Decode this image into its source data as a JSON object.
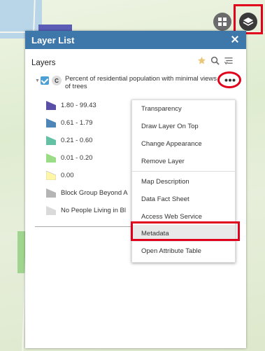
{
  "panel": {
    "title": "Layer List",
    "layers_label": "Layers"
  },
  "layer": {
    "badge": "C",
    "title": "Percent of residential population with minimal views of trees",
    "checked": true
  },
  "legend": [
    {
      "label": "1.80 - 99.43",
      "color": "#5a4fa6"
    },
    {
      "label": "0.61 - 1.79",
      "color": "#4f86b8"
    },
    {
      "label": "0.21 - 0.60",
      "color": "#64c1a6"
    },
    {
      "label": "0.01 - 0.20",
      "color": "#9bdc86"
    },
    {
      "label": "0.00",
      "color": "#fff7a6"
    },
    {
      "label": "Block Group Beyond A",
      "color": "#b5b5b5"
    },
    {
      "label": "No People Living in Bl",
      "color": "#dadada"
    }
  ],
  "menu": {
    "items": [
      "Transparency",
      "Draw Layer On Top",
      "Change Appearance",
      "Remove Layer",
      "Map Description",
      "Data Fact Sheet",
      "Access Web Service",
      "Metadata",
      "Open Attribute Table"
    ],
    "selected": "Metadata"
  },
  "colors": {
    "header": "#3e78ab",
    "highlight": "#e0001b",
    "checkbox": "#4a9fd4"
  },
  "icons": {
    "basemap": "basemap-gallery-icon",
    "layers": "layers-icon",
    "star": "star-icon",
    "search": "search-icon",
    "filter": "filter-icon",
    "more": "more-options-icon",
    "close": "close-icon"
  }
}
